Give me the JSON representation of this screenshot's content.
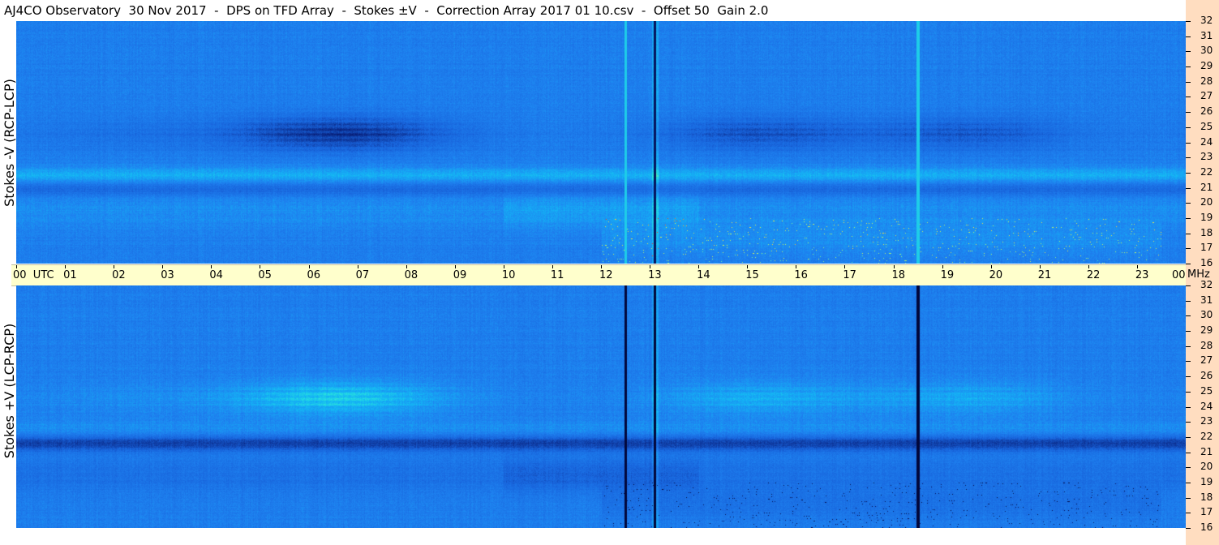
{
  "title": "AJ4CO Observatory  30 Nov 2017  -  DPS on TFD Array  -  Stokes ±V  -  Correction Array 2017 01 10.csv  -  Offset 50  Gain 2.0",
  "chart_data": [
    {
      "type": "heatmap",
      "panel": "top",
      "ylabel": "Stokes -V (RCP-LCP)",
      "x_range_utc_hours": [
        0,
        24
      ],
      "y_range_mhz": [
        16,
        32
      ],
      "y_ticks": [
        "32",
        "31",
        "30",
        "29",
        "28",
        "27",
        "26",
        "25",
        "24",
        "23",
        "22",
        "21",
        "20",
        "19",
        "18",
        "17",
        "16"
      ],
      "features": {
        "dark_band_mhz": [
          24,
          25.5
        ],
        "bright_band_mhz": [
          21.5,
          22.2
        ],
        "bursts_mhz": [
          16,
          19
        ],
        "bursts_utc": [
          12,
          23.5
        ],
        "vertical_lines_utc": [
          12.5,
          13.1,
          18.5
        ]
      }
    },
    {
      "type": "heatmap",
      "panel": "bottom",
      "ylabel": "Stokes +V (LCP-RCP)",
      "x_range_utc_hours": [
        0,
        24
      ],
      "y_range_mhz": [
        16,
        32
      ],
      "y_ticks": [
        "32",
        "31",
        "30",
        "29",
        "28",
        "27",
        "26",
        "25",
        "24",
        "23",
        "22",
        "21",
        "20",
        "19",
        "18",
        "17",
        "16"
      ],
      "features": {
        "bright_band_mhz": [
          24,
          25.5
        ],
        "dark_band_mhz": [
          21.3,
          22.2
        ],
        "bursts_mhz": [
          16,
          19
        ],
        "bursts_utc": [
          12,
          23.5
        ],
        "vertical_lines_utc": [
          12.5,
          13.1,
          18.5
        ]
      }
    }
  ],
  "time_axis": {
    "labels": [
      "00  UTC",
      "01",
      "02",
      "03",
      "04",
      "05",
      "06",
      "07",
      "08",
      "09",
      "10",
      "11",
      "12",
      "13",
      "14",
      "15",
      "16",
      "17",
      "18",
      "19",
      "20",
      "21",
      "22",
      "23",
      "00"
    ],
    "unit": "MHz"
  },
  "colors": {
    "background": "#ffffff",
    "time_bar": "#ffffcc",
    "freq_axis": "#ffddc0",
    "heat_base": "#1e7be6"
  }
}
